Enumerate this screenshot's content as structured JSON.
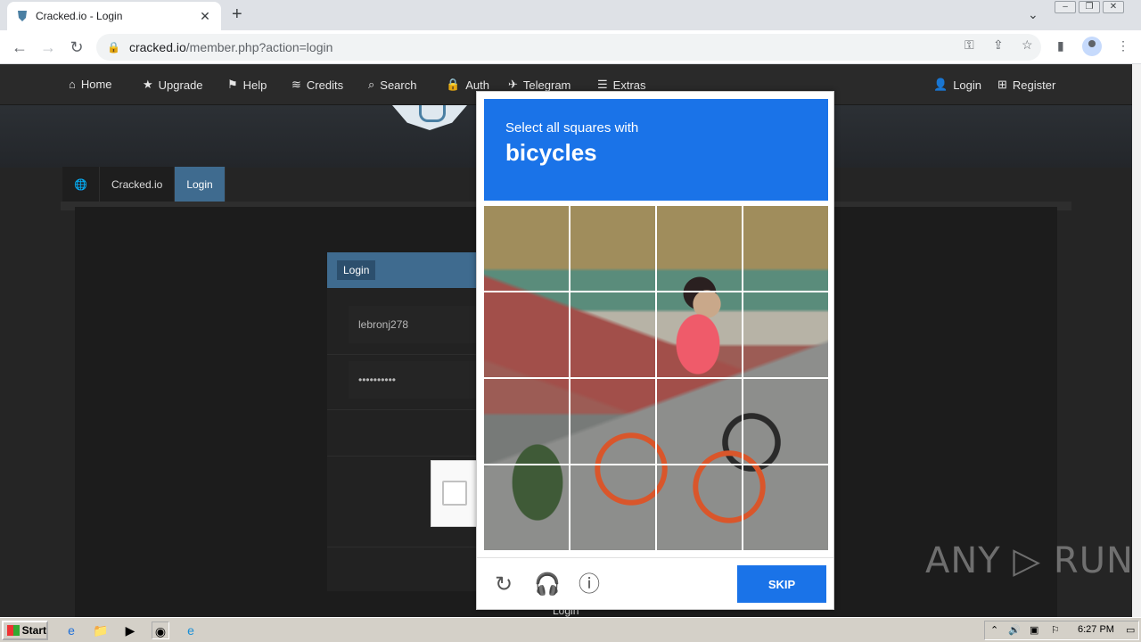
{
  "browser": {
    "tab_title": "Cracked.io - Login",
    "tab_close": "✕",
    "new_tab": "+",
    "url_host": "cracked.io",
    "url_path": "/member.php?action=login"
  },
  "site_nav": {
    "items": [
      {
        "icon": "⌂",
        "label": "Home"
      },
      {
        "icon": "★",
        "label": "Upgrade"
      },
      {
        "icon": "⚑",
        "label": "Help"
      },
      {
        "icon": "≋",
        "label": "Credits"
      },
      {
        "icon": "⌕",
        "label": "Search"
      },
      {
        "icon": "🔒",
        "label": "Auth"
      },
      {
        "icon": "✈",
        "label": "Telegram"
      },
      {
        "icon": "☰",
        "label": "Extras"
      }
    ],
    "login": "Login",
    "register": "Register"
  },
  "breadcrumb": [
    "Cracked.io",
    "Login"
  ],
  "login_panel": {
    "heading": "Login",
    "username": "lebronj278",
    "password": "••••••••••",
    "bottom_label": "Login"
  },
  "captcha": {
    "instruction": "Select all squares with",
    "target": "bicycles",
    "skip": "SKIP"
  },
  "watermark": "ANY ▷ RUN",
  "taskbar": {
    "start": "Start",
    "clock": "6:27 PM"
  },
  "colors": {
    "captcha_blue": "#1a73e8",
    "site_accent": "#3f6b8f"
  }
}
